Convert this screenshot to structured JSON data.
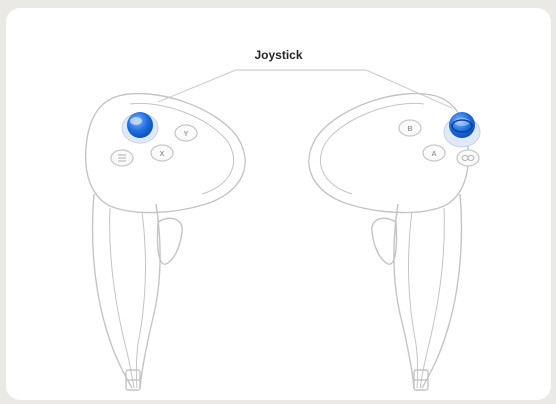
{
  "diagram": {
    "callout_label": "Joystick",
    "left_controller": {
      "buttons": [
        "Y",
        "X"
      ]
    },
    "right_controller": {
      "buttons": [
        "B",
        "A"
      ]
    },
    "colors": {
      "frame": "#ffffff",
      "backdrop": "#ebe9e5",
      "outline": "#c4c4c4",
      "joystick": "#1e6fe0"
    }
  }
}
